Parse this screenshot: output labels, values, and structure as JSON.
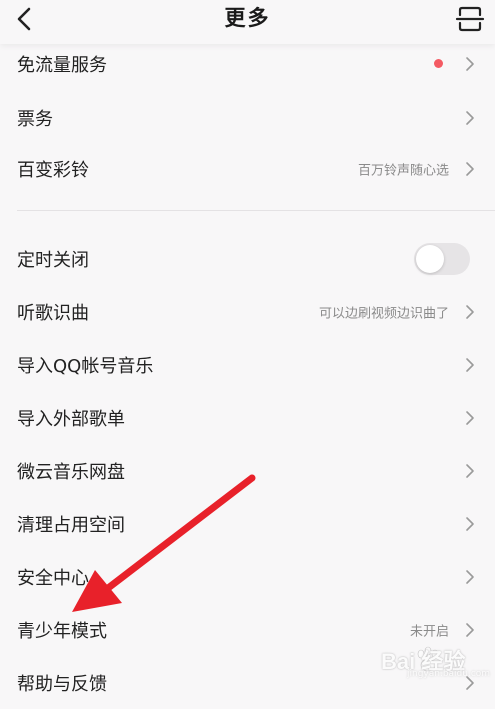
{
  "header": {
    "title": "更多",
    "back_icon": "chevron-left-icon",
    "scan_icon": "scan-icon"
  },
  "rows": [
    {
      "label": "免流量服务",
      "value": "",
      "dot": true
    },
    {
      "label": "票务",
      "value": ""
    },
    {
      "label": "百变彩铃",
      "value": "百万铃声随心选"
    },
    {
      "label": "定时关闭",
      "value": "",
      "toggle": false
    },
    {
      "label": "听歌识曲",
      "value": "可以边刷视频边识曲了"
    },
    {
      "label": "导入QQ帐号音乐",
      "value": ""
    },
    {
      "label": "导入外部歌单",
      "value": ""
    },
    {
      "label": "微云音乐网盘",
      "value": ""
    },
    {
      "label": "清理占用空间",
      "value": ""
    },
    {
      "label": "安全中心",
      "value": ""
    },
    {
      "label": "青少年模式",
      "value": "未开启"
    },
    {
      "label": "帮助与反馈",
      "value": ""
    }
  ],
  "colors": {
    "background": "#f8f7f8",
    "red_dot": "#f45a63",
    "annotation_arrow": "#e8212a",
    "secondary_text": "#8a8a8a"
  },
  "watermark": {
    "brand": "Bai 经验",
    "sub": "jingyan.baidu.com"
  }
}
